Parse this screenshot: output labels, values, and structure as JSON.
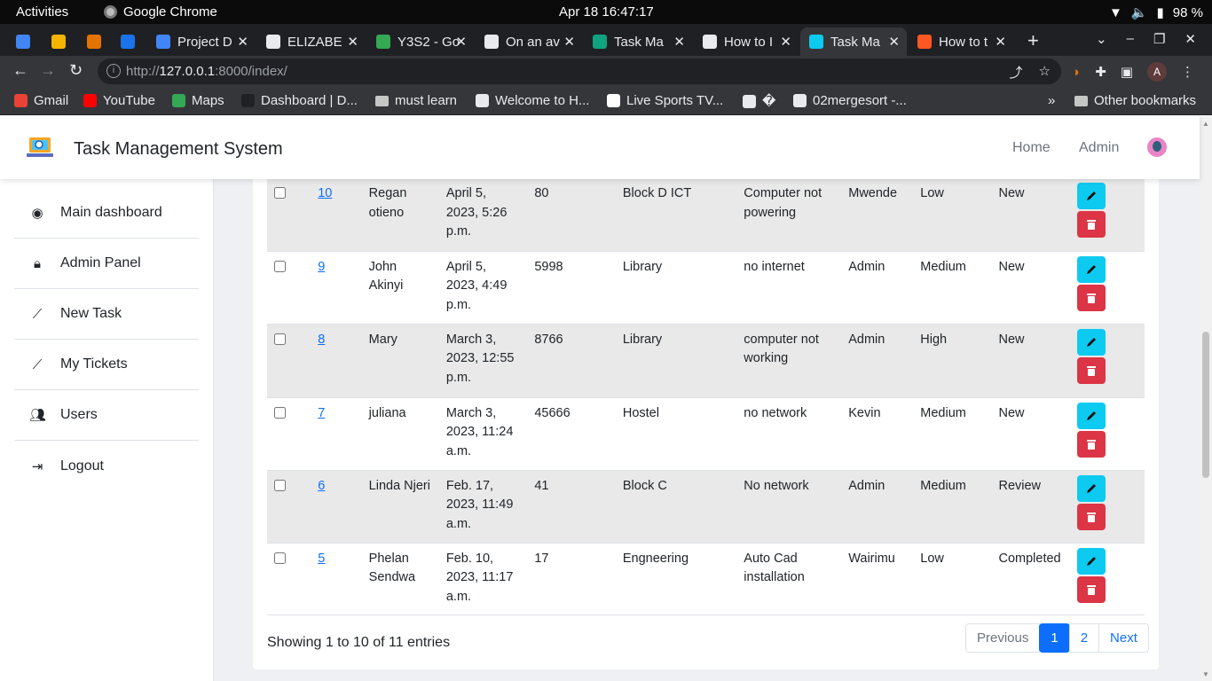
{
  "os_bar": {
    "activities": "Activities",
    "app_name": "Google Chrome",
    "datetime": "Apr 18  16:47:17",
    "battery": "98 %"
  },
  "tabs": [
    {
      "title": "",
      "color": "#4285f4"
    },
    {
      "title": "",
      "color": "#f4b400"
    },
    {
      "title": "",
      "color": "#e37400"
    },
    {
      "title": "",
      "color": "#1a73e8"
    },
    {
      "title": "Project D",
      "color": "#4285f4"
    },
    {
      "title": "ELIZABE",
      "color": "#e8eaed"
    },
    {
      "title": "Y3S2 - Go",
      "color": "#34a853"
    },
    {
      "title": "On an av",
      "color": "#e8eaed"
    },
    {
      "title": "Task Ma",
      "color": "#10a37f"
    },
    {
      "title": "How to I",
      "color": "#e8eaed"
    },
    {
      "title": "Task Ma",
      "color": "#0dcaf0",
      "active": true
    },
    {
      "title": "How to t",
      "color": "#ff5722"
    }
  ],
  "address": {
    "url_prefix": "http://",
    "url_host": "127.0.0.1",
    "url_rest": ":8000/index/",
    "profile_initial": "A"
  },
  "bookmarks": [
    {
      "label": "Gmail",
      "color": "#ea4335"
    },
    {
      "label": "YouTube",
      "color": "#ff0000"
    },
    {
      "label": "Maps",
      "color": "#34a853"
    },
    {
      "label": "Dashboard | D...",
      "color": "#202124"
    },
    {
      "label": "must learn",
      "folder": true
    },
    {
      "label": "Welcome to H...",
      "color": "#e8eaed"
    },
    {
      "label": "Live Sports TV...",
      "color": "#ffffff"
    },
    {
      "label": "�",
      "color": "#e8eaed"
    },
    {
      "label": "02mergesort -...",
      "color": "#e8eaed"
    }
  ],
  "bookmarks_more": "»",
  "other_bookmarks": "Other bookmarks",
  "app": {
    "brand": "Task Management System",
    "nav_home": "Home",
    "nav_admin": "Admin"
  },
  "sidebar": [
    {
      "label": "Main dashboard",
      "icon": "dashboard-icon"
    },
    {
      "label": "Admin Panel",
      "icon": "lock-icon"
    },
    {
      "label": "New Task",
      "icon": "chart-line-icon"
    },
    {
      "label": "My Tickets",
      "icon": "chart-line-icon"
    },
    {
      "label": "Users",
      "icon": "users-icon"
    },
    {
      "label": "Logout",
      "icon": "logout-icon"
    }
  ],
  "rows": [
    {
      "id": "10",
      "name": "Regan otieno",
      "date": "April 5, 2023, 5:26 p.m.",
      "phone": "80",
      "location": "Block D ICT",
      "issue": "Computer not powering",
      "assignee": "Mwende",
      "priority": "Low",
      "status": "New"
    },
    {
      "id": "9",
      "name": "John Akinyi",
      "date": "April 5, 2023, 4:49 p.m.",
      "phone": "5998",
      "location": "Library",
      "issue": "no internet",
      "assignee": "Admin",
      "priority": "Medium",
      "status": "New"
    },
    {
      "id": "8",
      "name": "Mary",
      "date": "March 3, 2023, 12:55 p.m.",
      "phone": "8766",
      "location": "Library",
      "issue": "computer not working",
      "assignee": "Admin",
      "priority": "High",
      "status": "New"
    },
    {
      "id": "7",
      "name": "juliana",
      "date": "March 3, 2023, 11:24 a.m.",
      "phone": "45666",
      "location": "Hostel",
      "issue": "no network",
      "assignee": "Kevin",
      "priority": "Medium",
      "status": "New"
    },
    {
      "id": "6",
      "name": "Linda Njeri",
      "date": "Feb. 17, 2023, 11:49 a.m.",
      "phone": "41",
      "location": "Block C",
      "issue": "No network",
      "assignee": "Admin",
      "priority": "Medium",
      "status": "Review"
    },
    {
      "id": "5",
      "name": "Phelan Sendwa",
      "date": "Feb. 10, 2023, 11:17 a.m.",
      "phone": "17",
      "location": "Engneering",
      "issue": "Auto Cad installation",
      "assignee": "Wairimu",
      "priority": "Low",
      "status": "Completed"
    }
  ],
  "footer": {
    "showing": "Showing 1 to 10 of 11 entries",
    "prev": "Previous",
    "pages": [
      "1",
      "2"
    ],
    "current_page": "1",
    "next": "Next"
  }
}
